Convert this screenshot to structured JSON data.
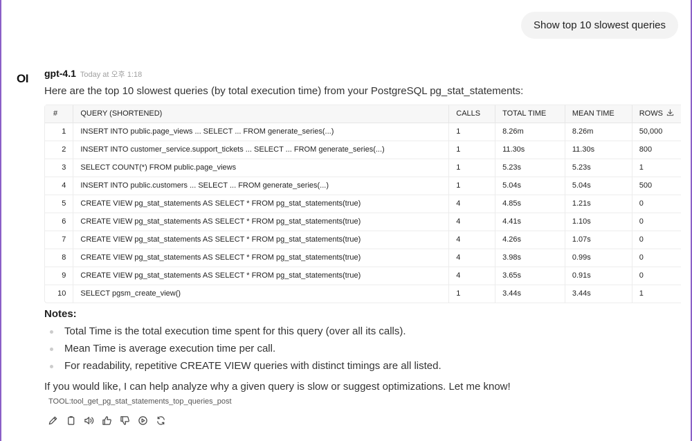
{
  "user_message": "Show top 10 slowest queries",
  "assistant": {
    "avatar_text": "OI",
    "model": "gpt-4.1",
    "timestamp": "Today at 오후 1:18",
    "intro": "Here are the top 10 slowest queries (by total execution time) from your PostgreSQL pg_stat_statements:",
    "table": {
      "headers": [
        "#",
        "QUERY (SHORTENED)",
        "CALLS",
        "TOTAL TIME",
        "MEAN TIME",
        "ROWS"
      ],
      "rows": [
        [
          "1",
          "INSERT INTO public.page_views ... SELECT ... FROM generate_series(...)",
          "1",
          "8.26m",
          "8.26m",
          "50,000"
        ],
        [
          "2",
          "INSERT INTO customer_service.support_tickets ... SELECT ... FROM generate_series(...)",
          "1",
          "11.30s",
          "11.30s",
          "800"
        ],
        [
          "3",
          "SELECT COUNT(*) FROM public.page_views",
          "1",
          "5.23s",
          "5.23s",
          "1"
        ],
        [
          "4",
          "INSERT INTO public.customers ... SELECT ... FROM generate_series(...)",
          "1",
          "5.04s",
          "5.04s",
          "500"
        ],
        [
          "5",
          "CREATE VIEW pg_stat_statements AS SELECT * FROM pg_stat_statements(true)",
          "4",
          "4.85s",
          "1.21s",
          "0"
        ],
        [
          "6",
          "CREATE VIEW pg_stat_statements AS SELECT * FROM pg_stat_statements(true)",
          "4",
          "4.41s",
          "1.10s",
          "0"
        ],
        [
          "7",
          "CREATE VIEW pg_stat_statements AS SELECT * FROM pg_stat_statements(true)",
          "4",
          "4.26s",
          "1.07s",
          "0"
        ],
        [
          "8",
          "CREATE VIEW pg_stat_statements AS SELECT * FROM pg_stat_statements(true)",
          "4",
          "3.98s",
          "0.99s",
          "0"
        ],
        [
          "9",
          "CREATE VIEW pg_stat_statements AS SELECT * FROM pg_stat_statements(true)",
          "4",
          "3.65s",
          "0.91s",
          "0"
        ],
        [
          "10",
          "SELECT pgsm_create_view()",
          "1",
          "3.44s",
          "3.44s",
          "1"
        ]
      ]
    },
    "notes_title": "Notes:",
    "notes": [
      "Total Time is the total execution time spent for this query (over all its calls).",
      "Mean Time is average execution time per call.",
      "For readability, repetitive CREATE VIEW queries with distinct timings are all listed."
    ],
    "followup": "If you would like, I can help analyze why a given query is slow or suggest optimizations. Let me know!",
    "tool_line": "TOOL:tool_get_pg_stat_statements_top_queries_post",
    "actions": [
      {
        "name": "edit-icon"
      },
      {
        "name": "copy-icon"
      },
      {
        "name": "speaker-icon"
      },
      {
        "name": "thumbs-up-icon"
      },
      {
        "name": "thumbs-down-icon"
      },
      {
        "name": "play-icon"
      },
      {
        "name": "regenerate-icon"
      }
    ]
  }
}
